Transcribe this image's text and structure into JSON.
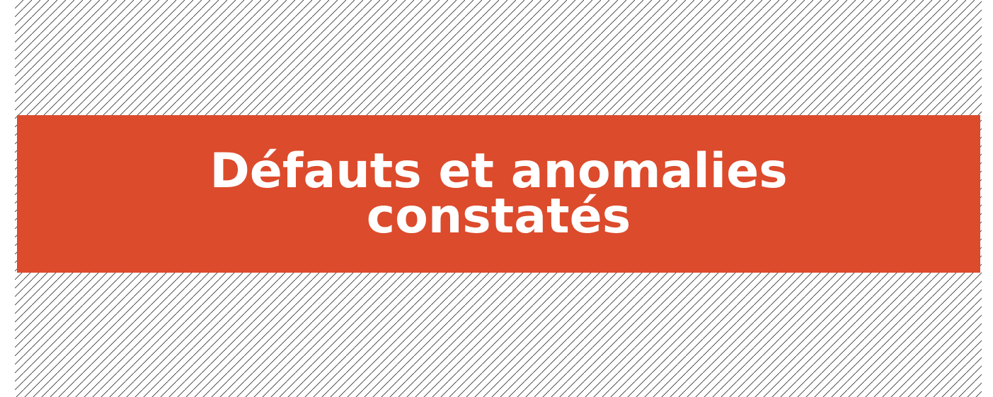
{
  "slide": {
    "title": "Défauts et anomalies constatés"
  },
  "colors": {
    "band": "#DC4B2C",
    "hatch": "#3a3a3a",
    "background": "#FFFFFF",
    "title_text": "#FFFFFF"
  }
}
